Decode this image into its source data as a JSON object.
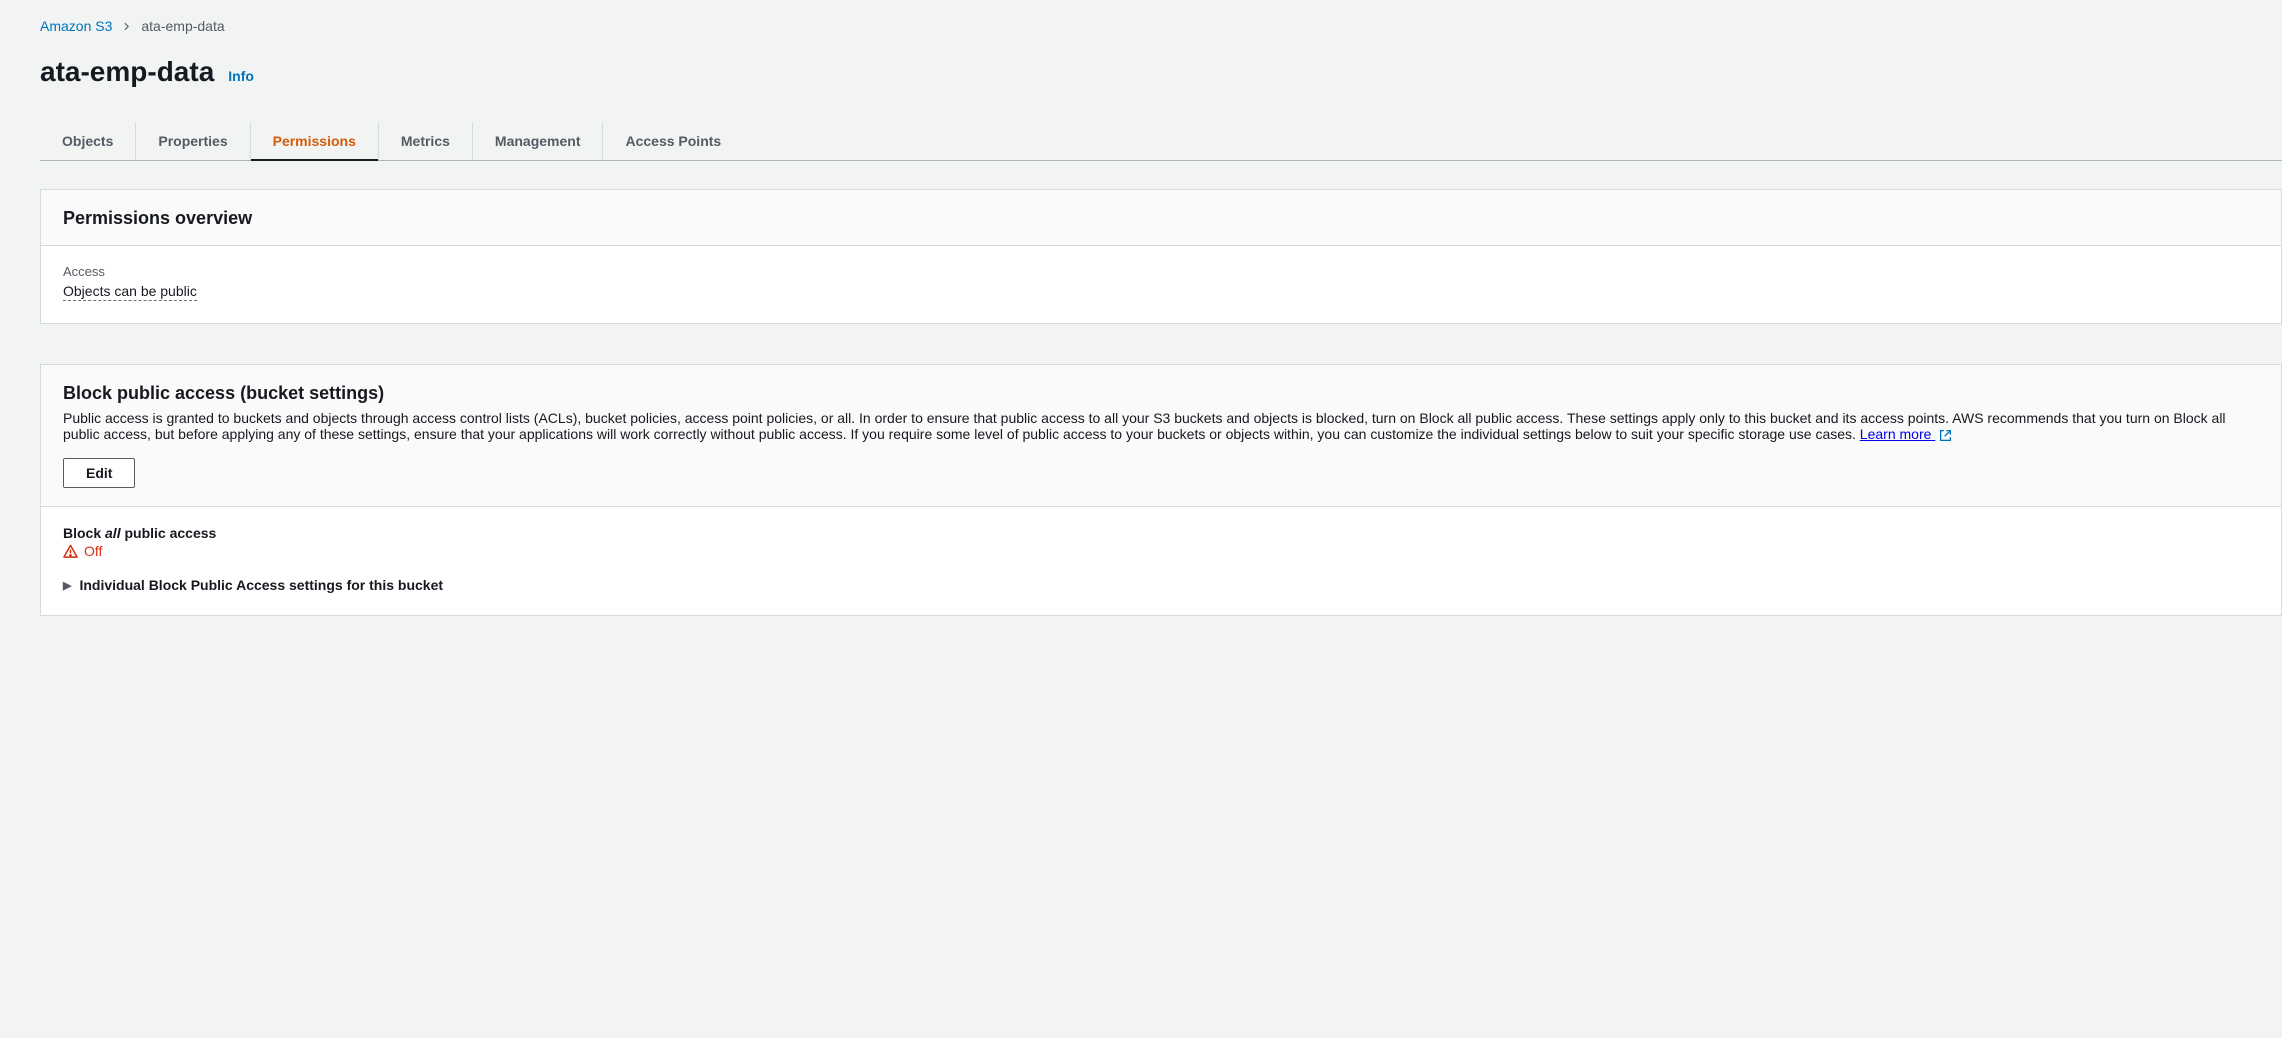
{
  "breadcrumb": {
    "root": "Amazon S3",
    "current": "ata-emp-data"
  },
  "page": {
    "title": "ata-emp-data",
    "info_label": "Info"
  },
  "tabs": [
    {
      "label": "Objects",
      "active": false
    },
    {
      "label": "Properties",
      "active": false
    },
    {
      "label": "Permissions",
      "active": true
    },
    {
      "label": "Metrics",
      "active": false
    },
    {
      "label": "Management",
      "active": false
    },
    {
      "label": "Access Points",
      "active": false
    }
  ],
  "permissions_overview": {
    "heading": "Permissions overview",
    "access_label": "Access",
    "access_value": "Objects can be public"
  },
  "block_public": {
    "heading": "Block public access (bucket settings)",
    "description": "Public access is granted to buckets and objects through access control lists (ACLs), bucket policies, access point policies, or all. In order to ensure that public access to all your S3 buckets and objects is blocked, turn on Block all public access. These settings apply only to this bucket and its access points. AWS recommends that you turn on Block all public access, but before applying any of these settings, ensure that your applications will work correctly without public access. If you require some level of public access to your buckets or objects within, you can customize the individual settings below to suit your specific storage use cases.",
    "learn_more": "Learn more",
    "edit_label": "Edit",
    "block_all_prefix": "Block ",
    "block_all_em": "all",
    "block_all_suffix": " public access",
    "status": "Off",
    "expand_label": "Individual Block Public Access settings for this bucket"
  }
}
